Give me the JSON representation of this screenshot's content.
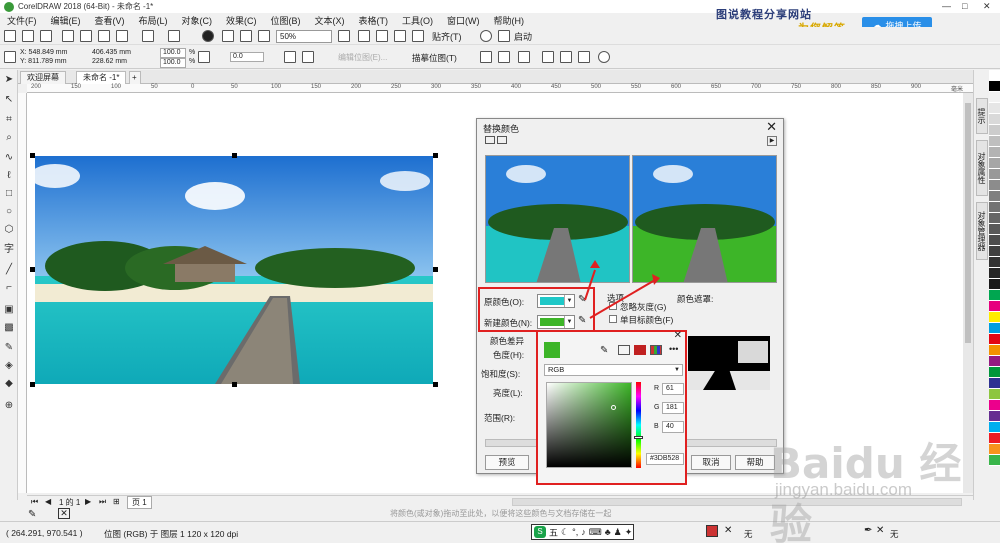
{
  "app": {
    "window_title": "CorelDRAW 2018 (64-Bit) - 未命名 -1*",
    "watermark_blue": "图说教程分享网站",
    "watermark_yellow": "为您解答",
    "upload_button": "拖拽上传",
    "window_controls": [
      "—",
      "□",
      "✕"
    ]
  },
  "menu": [
    "文件(F)",
    "编辑(E)",
    "查看(V)",
    "布局(L)",
    "对象(C)",
    "效果(C)",
    "位图(B)",
    "文本(X)",
    "表格(T)",
    "工具(O)",
    "窗口(W)",
    "帮助(H)"
  ],
  "toolbar1": {
    "zoom": "50%",
    "snap_label": "贴齐(T)",
    "launch_label": "启动"
  },
  "toolbar2": {
    "x": "X: 548.849 mm",
    "y": "Y: 811.789 mm",
    "w": "406.435 mm",
    "h": "228.62 mm",
    "sx": "100.0",
    "sy": "100.0",
    "pct": "%",
    "angle": "0.0",
    "edit_bitmap": "编辑位图(E)...",
    "trace_bitmap": "描摹位图(T)"
  },
  "tabs": [
    "欢迎屏幕",
    "未命名 -1*"
  ],
  "ruler_marks": [
    "200",
    "150",
    "100",
    "50",
    "0",
    "50",
    "100",
    "150",
    "200",
    "250",
    "300",
    "350",
    "400",
    "450",
    "500",
    "550",
    "600",
    "650",
    "700",
    "750",
    "800",
    "850",
    "900",
    "毫米"
  ],
  "dialog": {
    "title": "替换颜色",
    "orig_color_label": "原颜色(O):",
    "orig_color": "#1EC8C8",
    "new_color_label": "新建颜色(N):",
    "new_color": "#3DB528",
    "options_label": "选项",
    "ignore_gray": "忽略灰度(G)",
    "single_target": "单目标颜色(F)",
    "color_mask": "颜色遮罩:",
    "color_diff": "颜色差异",
    "hue": "色度(H):",
    "saturation": "饱和度(S):",
    "brightness": "亮度(L):",
    "range": "范围(R):",
    "preview_btn": "预览",
    "cancel_btn": "取消",
    "help_btn": "帮助"
  },
  "color_picker": {
    "model": "RGB",
    "r_label": "R",
    "g_label": "G",
    "b_label": "B",
    "r": "61",
    "g": "181",
    "b": "40",
    "hex": "#3DB528"
  },
  "right_dock": [
    "提示",
    "对象属性",
    "对象管理器"
  ],
  "palette": [
    "#ffffff",
    "#000000",
    "#f2f2f2",
    "#e6e6e6",
    "#d9d9d9",
    "#cccccc",
    "#bfbfbf",
    "#b3b3b3",
    "#a6a6a6",
    "#999999",
    "#8c8c8c",
    "#808080",
    "#737373",
    "#666666",
    "#595959",
    "#4d4d4d",
    "#404040",
    "#333333",
    "#262626",
    "#1a1a1a",
    "#00a650",
    "#e6007e",
    "#ffed00",
    "#009ee0",
    "#e30613",
    "#f39200",
    "#951b81",
    "#00973a",
    "#2e3192",
    "#8dc63f",
    "#ec008c",
    "#662d91",
    "#00aeef",
    "#ed1c24",
    "#f7941d",
    "#39b54a"
  ],
  "pagebar": {
    "page_of": "1 的 1",
    "page_label": "页 1"
  },
  "hint": "将颜色(或对象)拖动至此处，以便将这些颜色与文档存储在一起",
  "status": {
    "coords": "( 264.291, 970.541 )",
    "object_info": "位图 (RGB) 于 图层 1 120 x 120 dpi",
    "fill_none": "无",
    "outline_none": "无",
    "ime_label": "五"
  },
  "baidu": {
    "logo": "Baidu 经验",
    "url": "jingyan.baidu.com"
  }
}
